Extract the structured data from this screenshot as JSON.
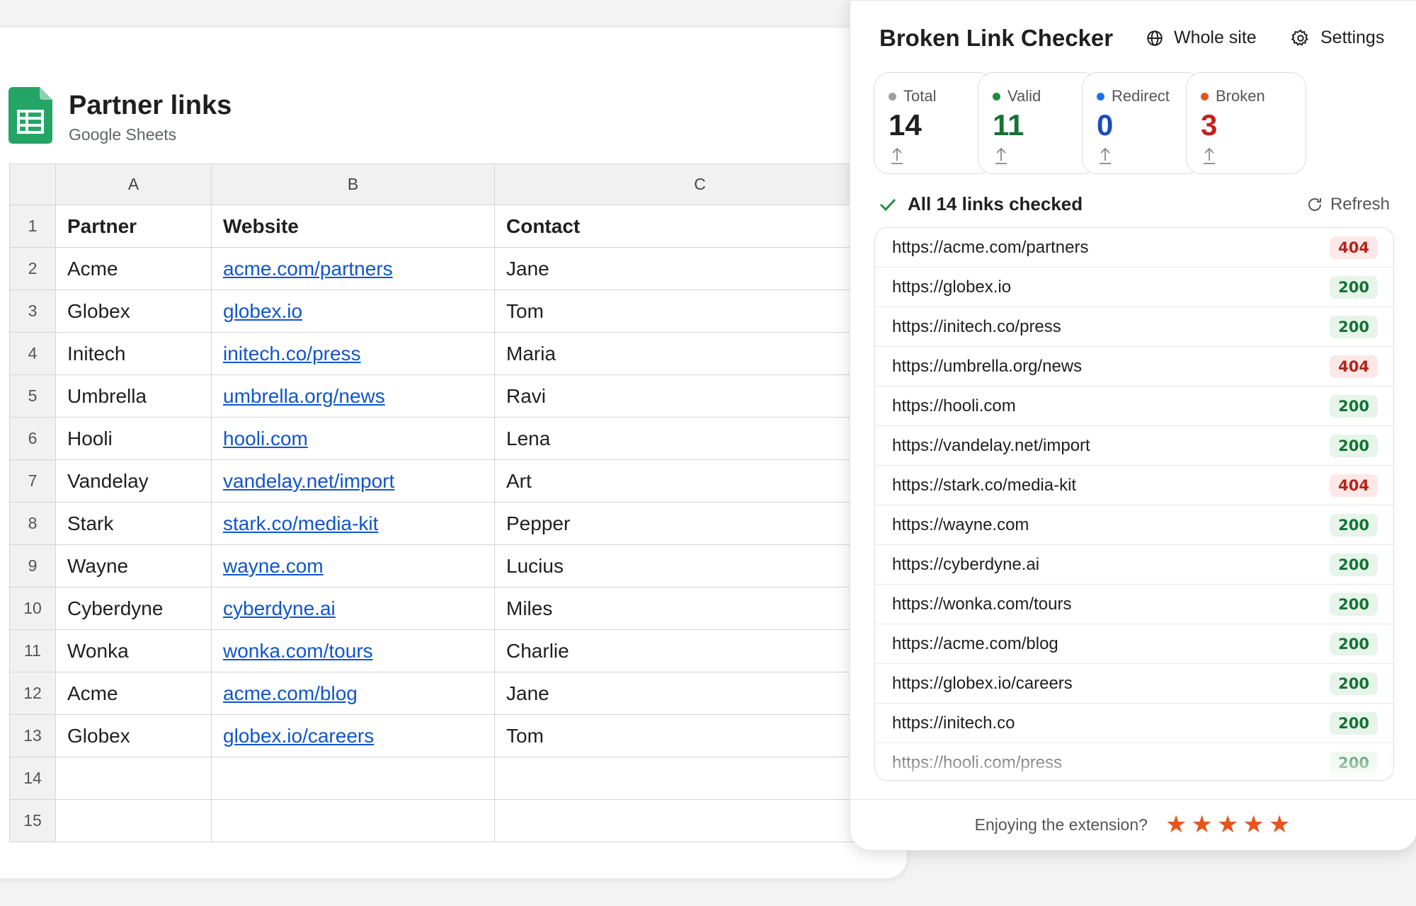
{
  "sheet": {
    "title": "Partner links",
    "subtitle": "Google Sheets",
    "columns": [
      "A",
      "B",
      "C"
    ],
    "rows": [
      {
        "num": "1",
        "partner": "Partner",
        "website": "Website",
        "contact": "Contact"
      },
      {
        "num": "2",
        "partner": "Acme",
        "website": "acme.com/partners",
        "contact": "Jane"
      },
      {
        "num": "3",
        "partner": "Globex",
        "website": "globex.io",
        "contact": "Tom"
      },
      {
        "num": "4",
        "partner": "Initech",
        "website": "initech.co/press",
        "contact": "Maria"
      },
      {
        "num": "5",
        "partner": "Umbrella",
        "website": "umbrella.org/news",
        "contact": "Ravi"
      },
      {
        "num": "6",
        "partner": "Hooli",
        "website": "hooli.com",
        "contact": "Lena"
      },
      {
        "num": "7",
        "partner": "Vandelay",
        "website": "vandelay.net/import",
        "contact": "Art"
      },
      {
        "num": "8",
        "partner": "Stark",
        "website": "stark.co/media-kit",
        "contact": "Pepper"
      },
      {
        "num": "9",
        "partner": "Wayne",
        "website": "wayne.com",
        "contact": "Lucius"
      },
      {
        "num": "10",
        "partner": "Cyberdyne",
        "website": "cyberdyne.ai",
        "contact": "Miles"
      },
      {
        "num": "11",
        "partner": "Wonka",
        "website": "wonka.com/tours",
        "contact": "Charlie"
      },
      {
        "num": "12",
        "partner": "Acme",
        "website": "acme.com/blog",
        "contact": "Jane"
      },
      {
        "num": "13",
        "partner": "Globex",
        "website": "globex.io/careers",
        "contact": "Tom"
      },
      {
        "num": "14",
        "partner": "",
        "website": "",
        "contact": ""
      },
      {
        "num": "15",
        "partner": "",
        "website": "",
        "contact": ""
      }
    ]
  },
  "popup": {
    "title": "Broken Link Checker",
    "scope_label": "Whole site",
    "settings_label": "Settings",
    "stats": [
      {
        "label": "Total",
        "value": "14",
        "dot_color": "#9e9e9e",
        "value_color": "#1f1f1f"
      },
      {
        "label": "Valid",
        "value": "11",
        "dot_color": "#1e8e3e",
        "value_color": "#137333"
      },
      {
        "label": "Redirect",
        "value": "0",
        "dot_color": "#1a73e8",
        "value_color": "#1a4fb4"
      },
      {
        "label": "Broken",
        "value": "3",
        "dot_color": "#e8541c",
        "value_color": "#c5221f"
      }
    ],
    "status_text": "All 14 links checked",
    "refresh_label": "Refresh",
    "links": [
      {
        "url": "https://acme.com/partners",
        "code": "404"
      },
      {
        "url": "https://globex.io",
        "code": "200"
      },
      {
        "url": "https://initech.co/press",
        "code": "200"
      },
      {
        "url": "https://umbrella.org/news",
        "code": "404"
      },
      {
        "url": "https://hooli.com",
        "code": "200"
      },
      {
        "url": "https://vandelay.net/import",
        "code": "200"
      },
      {
        "url": "https://stark.co/media-kit",
        "code": "404"
      },
      {
        "url": "https://wayne.com",
        "code": "200"
      },
      {
        "url": "https://cyberdyne.ai",
        "code": "200"
      },
      {
        "url": "https://wonka.com/tours",
        "code": "200"
      },
      {
        "url": "https://acme.com/blog",
        "code": "200"
      },
      {
        "url": "https://globex.io/careers",
        "code": "200"
      },
      {
        "url": "https://initech.co",
        "code": "200"
      },
      {
        "url": "https://hooli.com/press",
        "code": "200"
      }
    ],
    "footer_text": "Enjoying the extension?",
    "rating_stars": 5,
    "star_color": "#e8541c"
  }
}
